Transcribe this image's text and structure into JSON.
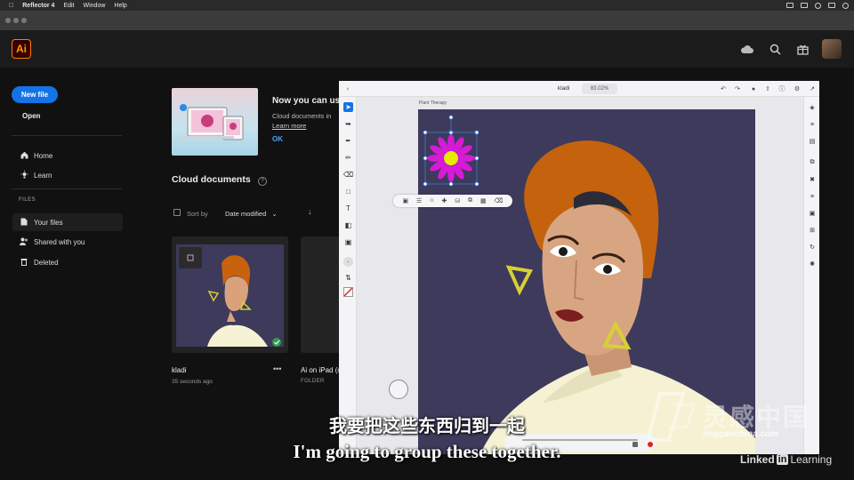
{
  "menubar": {
    "app_name": "Reflector 4",
    "items": [
      "Edit",
      "Window",
      "Help"
    ]
  },
  "app": {
    "logo_text": "Ai"
  },
  "sidebar": {
    "new_file_label": "New file",
    "open_label": "Open",
    "nav": [
      {
        "label": "Home",
        "icon": "home-icon"
      },
      {
        "label": "Learn",
        "icon": "lightbulb-icon"
      }
    ],
    "files_header": "FILES",
    "files": [
      {
        "label": "Your files",
        "icon": "file-icon",
        "selected": true
      },
      {
        "label": "Shared with you",
        "icon": "people-icon",
        "selected": false
      },
      {
        "label": "Deleted",
        "icon": "trash-icon",
        "selected": false
      }
    ]
  },
  "promo": {
    "title": "Now you can us",
    "text": "Cloud documents in",
    "link": "Learn more",
    "ok": "OK"
  },
  "cloud": {
    "title": "Cloud documents",
    "sort_label": "Sort by",
    "sort_value": "Date modified",
    "cards": [
      {
        "name": "kladi",
        "meta": "35 seconds ago",
        "more": "•••"
      },
      {
        "name": "Ai on iPad (c",
        "meta": "FOLDER"
      }
    ]
  },
  "ipad": {
    "doc_name": "kladi",
    "zoom": "83.02%",
    "artboard_label": "Plant Therapy"
  },
  "subtitles": {
    "chinese": "我要把这些东西归到一起",
    "english": "I'm going to group these together."
  },
  "watermark": {
    "brand": "灵感中国",
    "url": "lingganchina.com"
  },
  "linkedin": {
    "linked": "Linked",
    "in": "in",
    "learning": "Learning"
  },
  "colors": {
    "accent": "#1473e6",
    "ai_orange": "#ff9a00",
    "artboard_bg": "#3d3a5c",
    "flower_magenta": "#d61ad6",
    "flower_center": "#e8e800"
  }
}
